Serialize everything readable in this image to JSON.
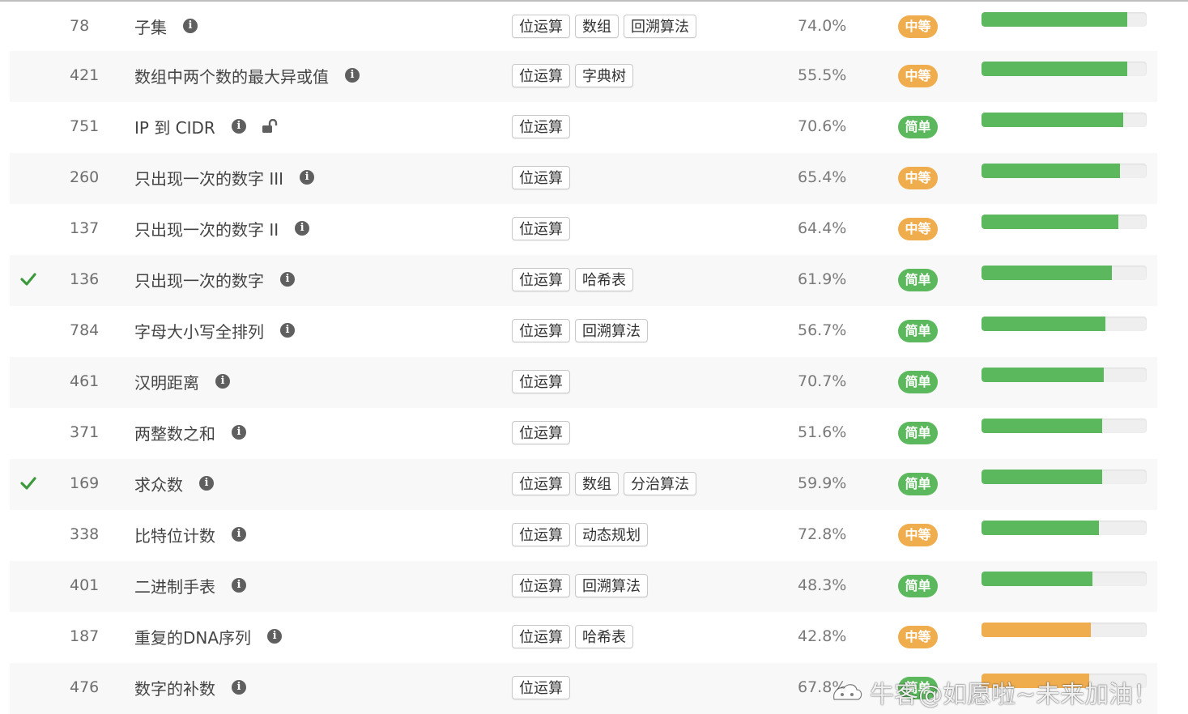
{
  "colors": {
    "medium": "#f0ad4e",
    "easy": "#5cb85c",
    "bar_green": "#5cb85c",
    "bar_orange": "#f0ad4e",
    "check": "#3c9a3c"
  },
  "icons": {
    "info": "info-circle-icon",
    "lock": "unlock-icon",
    "check": "check-icon"
  },
  "info_glyph": "i",
  "rows": [
    {
      "num": "78",
      "title": "子集",
      "tags": [
        "位运算",
        "数组",
        "回溯算法"
      ],
      "rate": "74.0%",
      "difficulty": "中等",
      "level": "medium",
      "progress": 0.88,
      "bar_color": "green",
      "solved": false,
      "locked": false
    },
    {
      "num": "421",
      "title": "数组中两个数的最大异或值",
      "tags": [
        "位运算",
        "字典树"
      ],
      "rate": "55.5%",
      "difficulty": "中等",
      "level": "medium",
      "progress": 0.88,
      "bar_color": "green",
      "solved": false,
      "locked": false
    },
    {
      "num": "751",
      "title": "IP 到 CIDR",
      "tags": [
        "位运算"
      ],
      "rate": "70.6%",
      "difficulty": "简单",
      "level": "easy",
      "progress": 0.86,
      "bar_color": "green",
      "solved": false,
      "locked": true
    },
    {
      "num": "260",
      "title": "只出现一次的数字 III",
      "tags": [
        "位运算"
      ],
      "rate": "65.4%",
      "difficulty": "中等",
      "level": "medium",
      "progress": 0.84,
      "bar_color": "green",
      "solved": false,
      "locked": false
    },
    {
      "num": "137",
      "title": "只出现一次的数字 II",
      "tags": [
        "位运算"
      ],
      "rate": "64.4%",
      "difficulty": "中等",
      "level": "medium",
      "progress": 0.83,
      "bar_color": "green",
      "solved": false,
      "locked": false
    },
    {
      "num": "136",
      "title": "只出现一次的数字",
      "tags": [
        "位运算",
        "哈希表"
      ],
      "rate": "61.9%",
      "difficulty": "简单",
      "level": "easy",
      "progress": 0.79,
      "bar_color": "green",
      "solved": true,
      "locked": false
    },
    {
      "num": "784",
      "title": "字母大小写全排列",
      "tags": [
        "位运算",
        "回溯算法"
      ],
      "rate": "56.7%",
      "difficulty": "简单",
      "level": "easy",
      "progress": 0.75,
      "bar_color": "green",
      "solved": false,
      "locked": false
    },
    {
      "num": "461",
      "title": "汉明距离",
      "tags": [
        "位运算"
      ],
      "rate": "70.7%",
      "difficulty": "简单",
      "level": "easy",
      "progress": 0.74,
      "bar_color": "green",
      "solved": false,
      "locked": false
    },
    {
      "num": "371",
      "title": "两整数之和",
      "tags": [
        "位运算"
      ],
      "rate": "51.6%",
      "difficulty": "简单",
      "level": "easy",
      "progress": 0.73,
      "bar_color": "green",
      "solved": false,
      "locked": false
    },
    {
      "num": "169",
      "title": "求众数",
      "tags": [
        "位运算",
        "数组",
        "分治算法"
      ],
      "rate": "59.9%",
      "difficulty": "简单",
      "level": "easy",
      "progress": 0.73,
      "bar_color": "green",
      "solved": true,
      "locked": false
    },
    {
      "num": "338",
      "title": "比特位计数",
      "tags": [
        "位运算",
        "动态规划"
      ],
      "rate": "72.8%",
      "difficulty": "中等",
      "level": "medium",
      "progress": 0.71,
      "bar_color": "green",
      "solved": false,
      "locked": false
    },
    {
      "num": "401",
      "title": "二进制手表",
      "tags": [
        "位运算",
        "回溯算法"
      ],
      "rate": "48.3%",
      "difficulty": "简单",
      "level": "easy",
      "progress": 0.67,
      "bar_color": "green",
      "solved": false,
      "locked": false
    },
    {
      "num": "187",
      "title": "重复的DNA序列",
      "tags": [
        "位运算",
        "哈希表"
      ],
      "rate": "42.8%",
      "difficulty": "中等",
      "level": "medium",
      "progress": 0.66,
      "bar_color": "orange",
      "solved": false,
      "locked": false
    },
    {
      "num": "476",
      "title": "数字的补数",
      "tags": [
        "位运算"
      ],
      "rate": "67.8%",
      "difficulty": "简单",
      "level": "easy",
      "progress": 0.65,
      "bar_color": "orange",
      "solved": false,
      "locked": false
    }
  ],
  "watermark": {
    "text": "牛客@如愿啦~未来加油！",
    "icon": "nowcoder-logo-icon"
  }
}
